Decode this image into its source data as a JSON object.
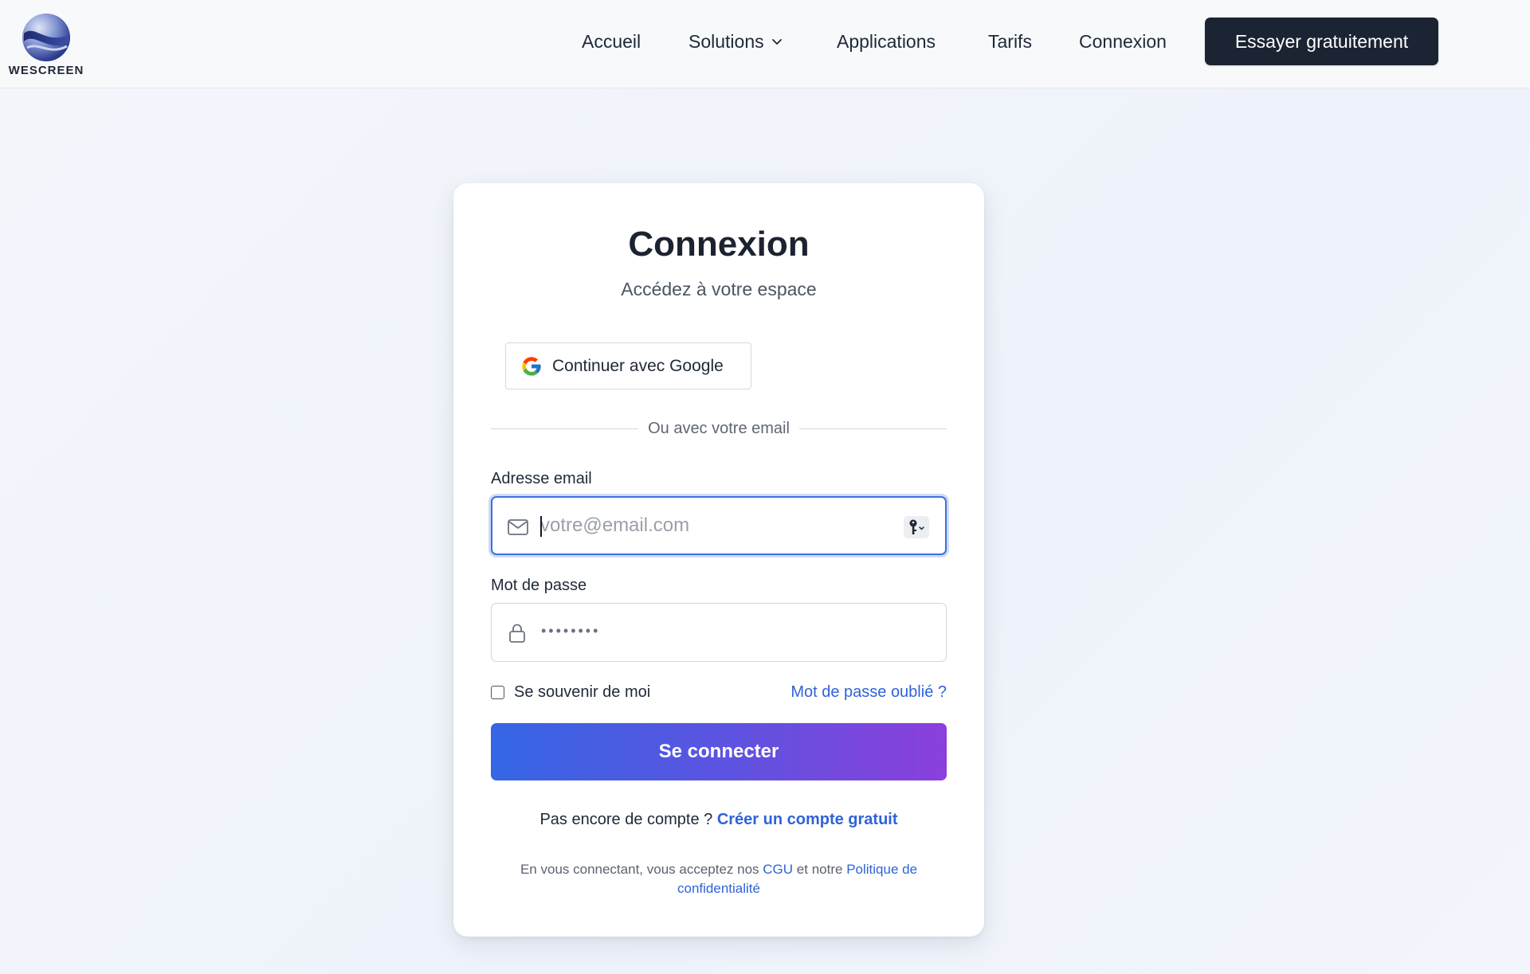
{
  "header": {
    "logo_text": "WESCREEN",
    "nav": {
      "accueil": "Accueil",
      "solutions": "Solutions",
      "applications": "Applications",
      "tarifs": "Tarifs",
      "connexion": "Connexion"
    },
    "cta_label": "Essayer gratuitement"
  },
  "login": {
    "title": "Connexion",
    "subtitle": "Accédez à votre espace",
    "google_label": "Continuer avec Google",
    "divider_text": "Ou avec votre email",
    "email_label": "Adresse email",
    "email_placeholder": "votre@email.com",
    "email_value": "",
    "password_label": "Mot de passe",
    "password_placeholder": "••••••••",
    "remember_label": "Se souvenir de moi",
    "remember_checked": false,
    "forgot_label": "Mot de passe oublié ?",
    "submit_label": "Se connecter",
    "signup_prompt": "Pas encore de compte ?",
    "signup_link": "Créer un compte gratuit",
    "terms_prefix": "En vous connectant, vous acceptez nos",
    "terms_cgu": "CGU",
    "terms_and": "et notre",
    "terms_privacy": "Politique de confidentialité"
  },
  "icons": {
    "logo": "wescreen-logo-icon",
    "chevron": "chevron-down-icon",
    "google": "google-icon",
    "email": "mail-icon",
    "password": "lock-icon",
    "password_manager": "key-icon"
  },
  "colors": {
    "accent": "#2f63d8",
    "cta_bg": "#1b2432",
    "submit_gradient_start": "#3466e4",
    "submit_gradient_end": "#8b3fdc",
    "focus_ring": "#3b6fe0"
  }
}
